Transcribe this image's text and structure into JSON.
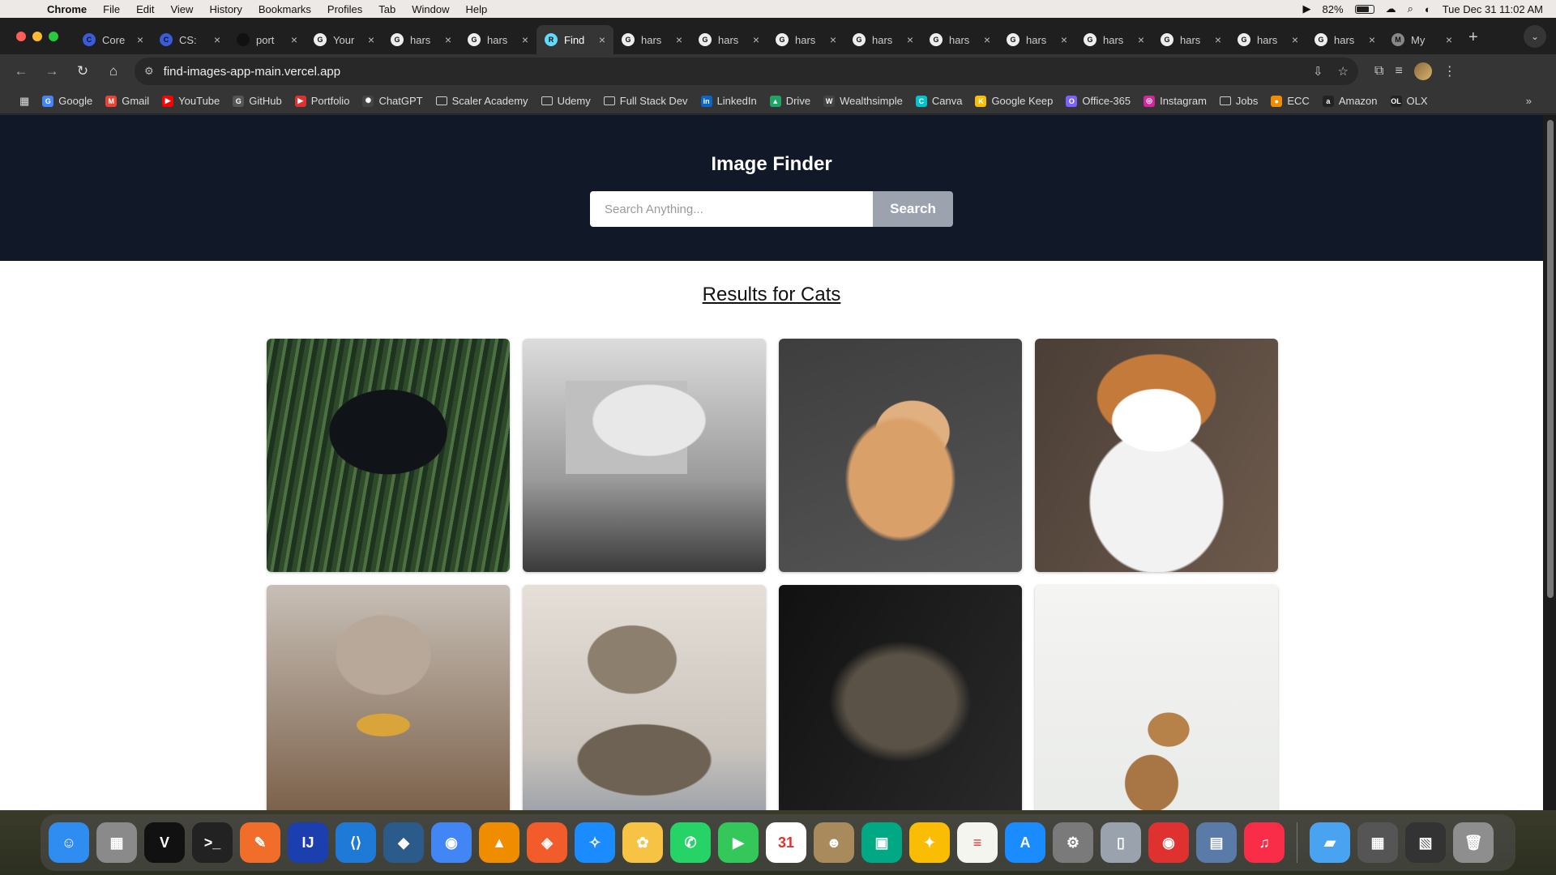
{
  "menubar": {
    "app_name": "Chrome",
    "menus": [
      "File",
      "Edit",
      "View",
      "History",
      "Bookmarks",
      "Profiles",
      "Tab",
      "Window",
      "Help"
    ],
    "battery": "82%",
    "datetime": "Tue Dec 31  11:02 AM"
  },
  "tabs": [
    {
      "title": "Core",
      "favicon": "C",
      "color": "#3b5bdb"
    },
    {
      "title": "CS: ",
      "favicon": "C",
      "color": "#3b5bdb"
    },
    {
      "title": "port",
      "favicon": "▲",
      "color": "#111111"
    },
    {
      "title": "Your",
      "favicon": "G",
      "color": "#eeeeee"
    },
    {
      "title": "hars",
      "favicon": "G",
      "color": "#eeeeee"
    },
    {
      "title": "hars",
      "favicon": "G",
      "color": "#eeeeee"
    },
    {
      "title": "Find",
      "favicon": "R",
      "color": "#61dafb",
      "active": true
    },
    {
      "title": "hars",
      "favicon": "G",
      "color": "#eeeeee"
    },
    {
      "title": "hars",
      "favicon": "G",
      "color": "#eeeeee"
    },
    {
      "title": "hars",
      "favicon": "G",
      "color": "#eeeeee"
    },
    {
      "title": "hars",
      "favicon": "G",
      "color": "#eeeeee"
    },
    {
      "title": "hars",
      "favicon": "G",
      "color": "#eeeeee"
    },
    {
      "title": "hars",
      "favicon": "G",
      "color": "#eeeeee"
    },
    {
      "title": "hars",
      "favicon": "G",
      "color": "#eeeeee"
    },
    {
      "title": "hars",
      "favicon": "G",
      "color": "#eeeeee"
    },
    {
      "title": "hars",
      "favicon": "G",
      "color": "#eeeeee"
    },
    {
      "title": "hars",
      "favicon": "G",
      "color": "#eeeeee"
    },
    {
      "title": "My ",
      "favicon": "M",
      "color": "#888888"
    }
  ],
  "toolbar": {
    "url": "find-images-app-main.vercel.app"
  },
  "bookmarks": [
    {
      "label": "Google",
      "icon": "G",
      "color": "#4285f4"
    },
    {
      "label": "Gmail",
      "icon": "M",
      "color": "#ea4335"
    },
    {
      "label": "YouTube",
      "icon": "▶",
      "color": "#ff0000"
    },
    {
      "label": "GitHub",
      "icon": "G",
      "color": "#555555"
    },
    {
      "label": "Portfolio",
      "icon": "▶",
      "color": "#e03131"
    },
    {
      "label": "ChatGPT",
      "icon": "✺",
      "color": "#444444"
    },
    {
      "label": "Scaler Academy",
      "folder": true
    },
    {
      "label": "Udemy",
      "folder": true
    },
    {
      "label": "Full Stack Dev",
      "folder": true
    },
    {
      "label": "LinkedIn",
      "icon": "in",
      "color": "#0a66c2"
    },
    {
      "label": "Drive",
      "icon": "▲",
      "color": "#1fa463"
    },
    {
      "label": "Wealthsimple",
      "icon": "W",
      "color": "#444444"
    },
    {
      "label": "Canva",
      "icon": "C",
      "color": "#00c4cc"
    },
    {
      "label": "Google Keep",
      "icon": "K",
      "color": "#fbbc04"
    },
    {
      "label": "Office-365",
      "icon": "O",
      "color": "#7b61ff"
    },
    {
      "label": "Instagram",
      "icon": "◎",
      "color": "#d6249f"
    },
    {
      "label": "Jobs",
      "folder": true
    },
    {
      "label": "ECC",
      "icon": "●",
      "color": "#f08c00"
    },
    {
      "label": "Amazon",
      "icon": "a",
      "color": "#222222"
    },
    {
      "label": "OLX",
      "icon": "OL",
      "color": "#222222"
    }
  ],
  "app": {
    "title": "Image Finder",
    "search_placeholder": "Search Anything...",
    "search_button": "Search",
    "results_heading": "Results for Cats"
  },
  "dock": [
    {
      "name": "finder",
      "color": "#2f8cf0",
      "glyph": "☺"
    },
    {
      "name": "launchpad",
      "color": "#8a8a8a",
      "glyph": "▦"
    },
    {
      "name": "vectorize",
      "color": "#111111",
      "glyph": "V"
    },
    {
      "name": "terminal",
      "color": "#222222",
      "glyph": ">_"
    },
    {
      "name": "pen-tool",
      "color": "#f06d2a",
      "glyph": "✎"
    },
    {
      "name": "intellij",
      "color": "#1b3fae",
      "glyph": "IJ"
    },
    {
      "name": "vscode",
      "color": "#1e7ad6",
      "glyph": "⟨⟩"
    },
    {
      "name": "mysql",
      "color": "#2b5b8a",
      "glyph": "◆"
    },
    {
      "name": "chrome",
      "color": "#4285f4",
      "glyph": "◉"
    },
    {
      "name": "vlc",
      "color": "#f08c00",
      "glyph": "▲"
    },
    {
      "name": "brave",
      "color": "#f25c2a",
      "glyph": "◈"
    },
    {
      "name": "safari",
      "color": "#1a8cff",
      "glyph": "✧"
    },
    {
      "name": "photos",
      "color": "#f6c344",
      "glyph": "✿"
    },
    {
      "name": "whatsapp",
      "color": "#25d366",
      "glyph": "✆"
    },
    {
      "name": "facetime",
      "color": "#34c759",
      "glyph": "▶"
    },
    {
      "name": "calendar",
      "color": "#ffffff",
      "glyph": "31"
    },
    {
      "name": "contacts",
      "color": "#a88a5c",
      "glyph": "☻"
    },
    {
      "name": "meet",
      "color": "#00a884",
      "glyph": "▣"
    },
    {
      "name": "keep",
      "color": "#fbbc04",
      "glyph": "✦"
    },
    {
      "name": "notes",
      "color": "#f5f5f0",
      "glyph": "≡"
    },
    {
      "name": "app-store",
      "color": "#1a8cff",
      "glyph": "A"
    },
    {
      "name": "system-settings",
      "color": "#7a7a7a",
      "glyph": "⚙"
    },
    {
      "name": "iphone-mirroring",
      "color": "#9aa3ad",
      "glyph": "▯"
    },
    {
      "name": "screen-recorder",
      "color": "#e03131",
      "glyph": "◉"
    },
    {
      "name": "preview",
      "color": "#5a7ba8",
      "glyph": "▤"
    },
    {
      "name": "music",
      "color": "#fa2d48",
      "glyph": "♫"
    },
    {
      "name": "folder",
      "color": "#4aa3f0",
      "glyph": "▰"
    },
    {
      "name": "downloads",
      "color": "#555555",
      "glyph": "▦"
    },
    {
      "name": "recent-screens",
      "color": "#333333",
      "glyph": "▧"
    },
    {
      "name": "trash",
      "color": "#8e8e8e",
      "glyph": "🗑"
    }
  ]
}
